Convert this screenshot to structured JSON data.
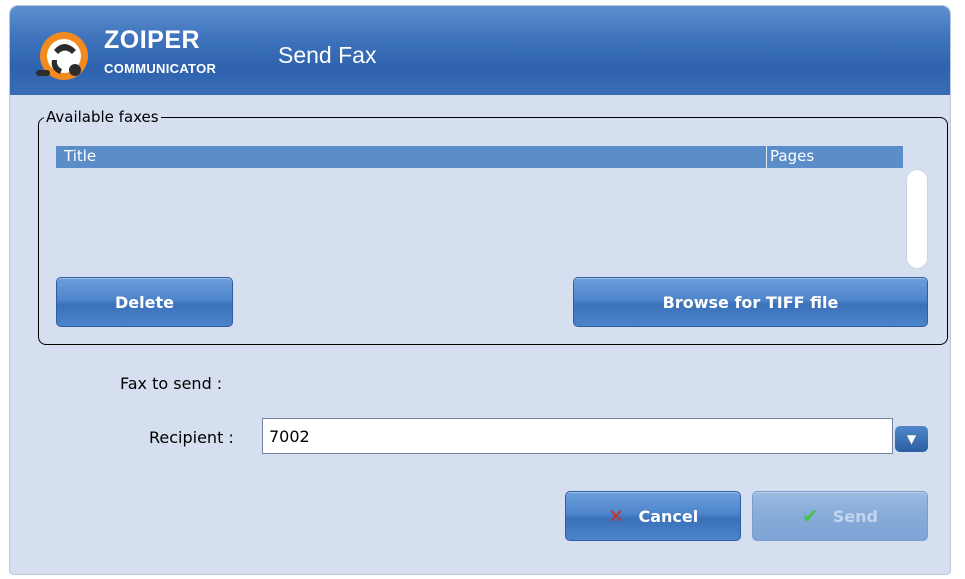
{
  "header": {
    "brand_name": "ZOIPER",
    "brand_sub": "COMMUNICATOR",
    "window_title": "Send Fax"
  },
  "available_faxes": {
    "legend": "Available faxes",
    "columns": [
      "Title",
      "Pages"
    ],
    "rows": []
  },
  "buttons": {
    "delete_label": "Delete",
    "browse_label": "Browse for TIFF file",
    "cancel_label": "Cancel",
    "send_label": "Send"
  },
  "form": {
    "fax_to_send_label": "Fax to send :",
    "recipient_label": "Recipient :",
    "recipient_value": "7002"
  },
  "icons": {
    "logo": "zoiper-logo-icon",
    "dropdown": "chevron-down-icon",
    "cancel": "x-icon",
    "send": "check-icon"
  },
  "colors": {
    "header": "#3f74bd",
    "accent": "#4e85cb",
    "logo_orange": "#f28a1f"
  }
}
